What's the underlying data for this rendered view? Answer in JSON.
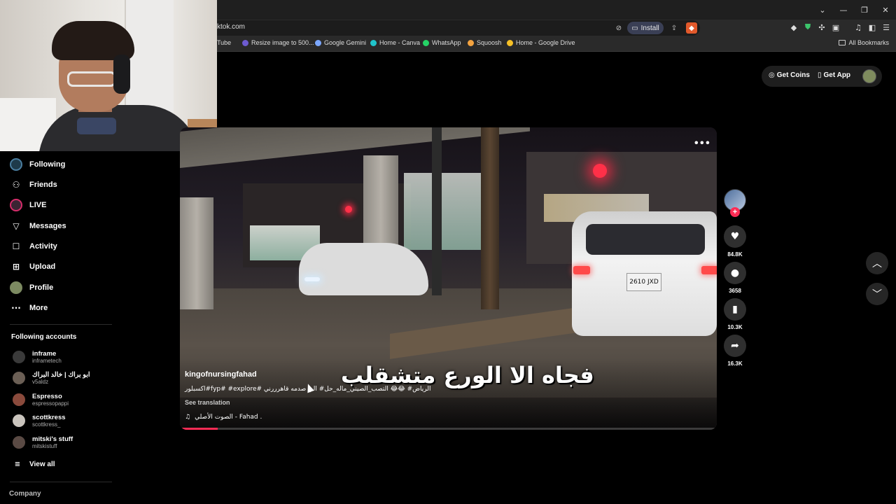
{
  "browser": {
    "url": "ktok.com",
    "install_label": "Install",
    "bookmarks": [
      {
        "label": "ouTube",
        "icon": "youtube-icon",
        "color": "#ff0000"
      },
      {
        "label": "Resize image to 500...",
        "icon": "resize-icon",
        "color": "#6d5bd0"
      },
      {
        "label": "Google Gemini",
        "icon": "gemini-icon",
        "color": "#7ba7ff"
      },
      {
        "label": "Home - Canva",
        "icon": "canva-icon",
        "color": "#20c4cb"
      },
      {
        "label": "WhatsApp",
        "icon": "whatsapp-icon",
        "color": "#25d366"
      },
      {
        "label": "Squoosh",
        "icon": "squoosh-icon",
        "color": "#f4a340"
      },
      {
        "label": "Home - Google Drive",
        "icon": "drive-icon",
        "color": "#f6c026"
      }
    ],
    "all_bookmarks": "All Bookmarks"
  },
  "sidebar": {
    "nav": [
      {
        "label": "Following",
        "icon": "following-avatar-icon"
      },
      {
        "label": "Friends",
        "icon": "friends-icon"
      },
      {
        "label": "LIVE",
        "icon": "live-icon"
      },
      {
        "label": "Messages",
        "icon": "messages-icon"
      },
      {
        "label": "Activity",
        "icon": "activity-icon"
      },
      {
        "label": "Upload",
        "icon": "upload-icon"
      },
      {
        "label": "Profile",
        "icon": "profile-avatar-icon"
      },
      {
        "label": "More",
        "icon": "more-icon"
      }
    ],
    "following_title": "Following accounts",
    "accounts": [
      {
        "name": "inframe",
        "handle": "inframetech",
        "color": "#3a3a3a"
      },
      {
        "name": "ابو براك | خالد البراك",
        "handle": "v5aldz",
        "color": "#6b5f55"
      },
      {
        "name": "Espresso",
        "handle": "espressopappi",
        "color": "#8a4a3c"
      },
      {
        "name": "scottkress",
        "handle": "scottkress_",
        "color": "#c9c4bd"
      },
      {
        "name": "mitski's stuff",
        "handle": "mitskistuff",
        "color": "#5a4a44"
      }
    ],
    "view_all": "View all",
    "company": "Company"
  },
  "header": {
    "get_coins": "Get Coins",
    "get_app": "Get App"
  },
  "video": {
    "caption_overlay": "فجاه الا الورع متشقلب",
    "username": "kingofnursingfahad",
    "description": "اكسبلور#fyp# #explore# الرياض# 😂😂 التصب_الصيني_ماله_حل# الي صدمه قاهرررني",
    "see_translation": "See translation",
    "music": "الصوت الأصلي - Fahad .",
    "plate": "2610 JXD",
    "progress": 0.07
  },
  "actions": {
    "likes": "84.8K",
    "comments": "3658",
    "saves": "10.3K",
    "shares": "16.3K"
  }
}
